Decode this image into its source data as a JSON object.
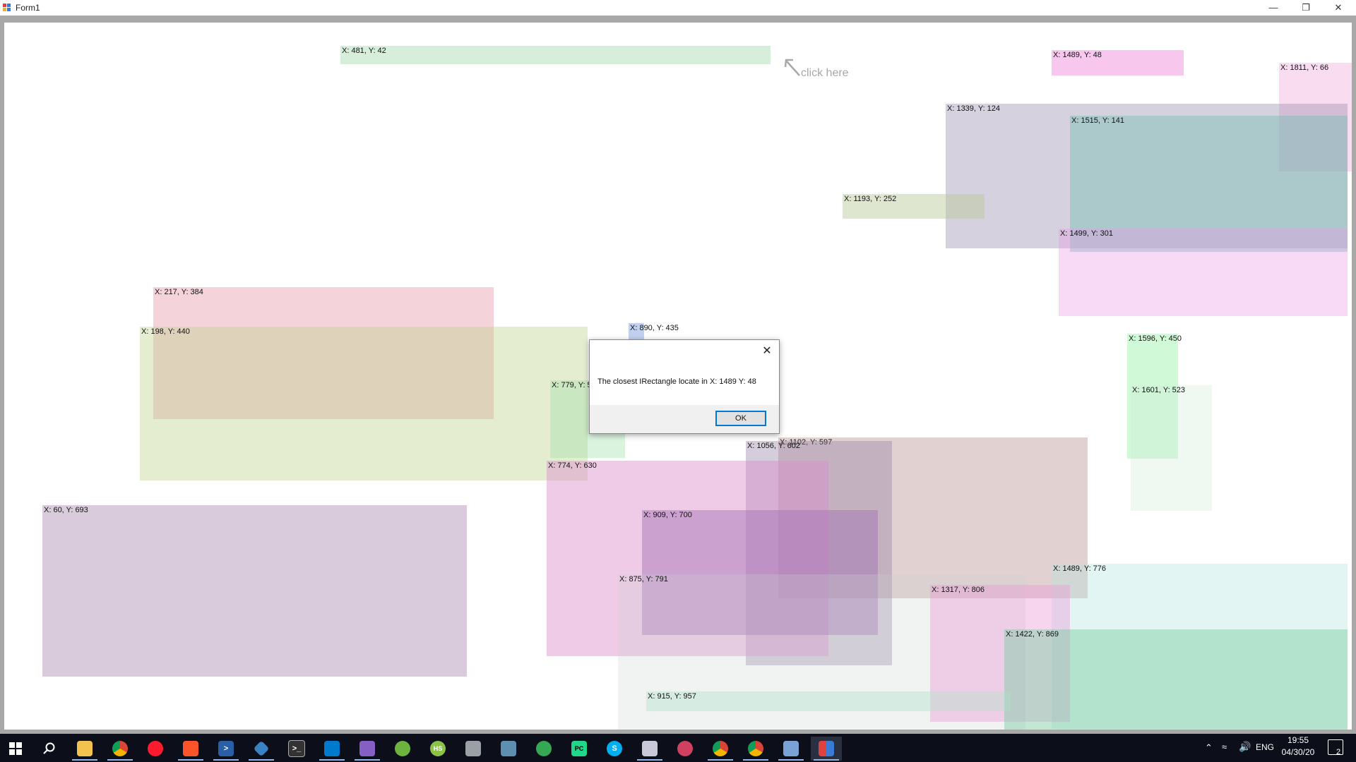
{
  "window": {
    "title": "Form1"
  },
  "hint": {
    "text": "click here"
  },
  "rect_labels": [
    "X: 481, Y: 42",
    "X: 1489, Y: 48",
    "X: 1811, Y: 66",
    "X: 1339, Y: 124",
    "X: 1515, Y: 141",
    "X: 1193, Y: 252",
    "X: 1499, Y: 301",
    "X: 217, Y: 384",
    "X: 198, Y: 440",
    "X: 890, Y: 435",
    "X: 779, Y: 5",
    "X: 1596, Y: 450",
    "X: 1601, Y: 523",
    "X: 1102, Y: 597",
    "X: 1056, Y: 602",
    "X: 774, Y: 630",
    "X: 60, Y: 693",
    "X: 909, Y: 700",
    "X: 1489, Y: 776",
    "X: 875, Y: 791",
    "X: 1317, Y: 806",
    "X: 1422, Y: 869",
    "X: 915, Y: 957"
  ],
  "dialog": {
    "message": "The closest IRectangle locate in X: 1489 Y: 48",
    "ok_label": "OK"
  },
  "taskbar": {
    "apps": [
      "start",
      "search",
      "file-explorer",
      "chrome",
      "opera",
      "brave",
      "powershell",
      "git",
      "terminal",
      "vscode",
      "visual-studio",
      "spring",
      "hs",
      "database",
      "gallery",
      "maps",
      "pycharm",
      "skype",
      "app-a",
      "app-b",
      "chrome-2",
      "chrome-3",
      "app-c",
      "form1"
    ],
    "language": "ENG",
    "time": "19:55",
    "date": "04/30/20",
    "notification_count": "2"
  }
}
